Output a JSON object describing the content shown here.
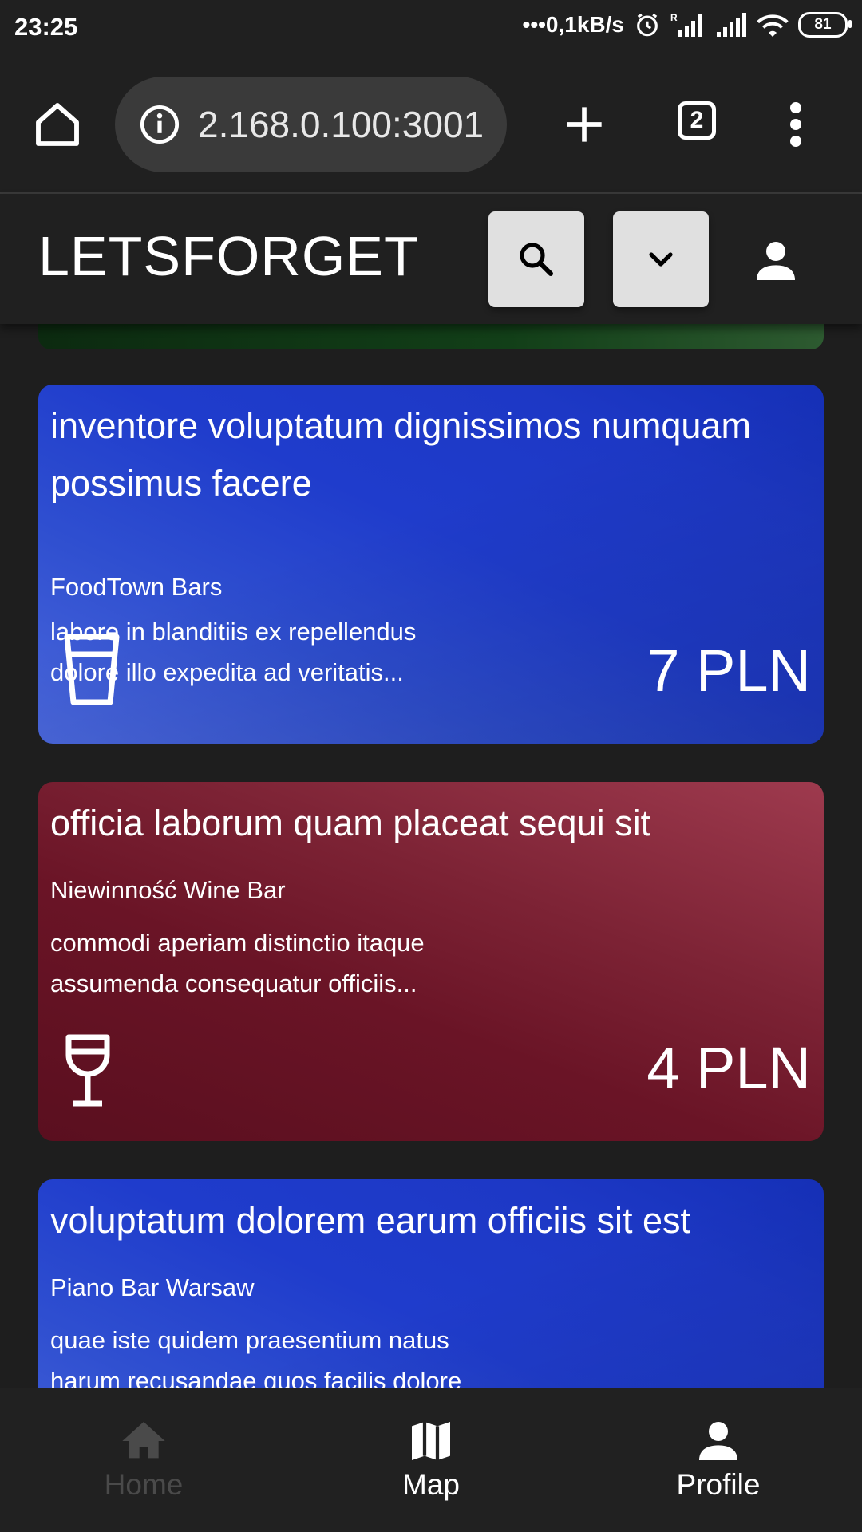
{
  "status": {
    "time": "23:25",
    "net_speed": "•••0,1kB/s",
    "battery": "81"
  },
  "browser": {
    "url": "2.168.0.100:3001",
    "tab_count": "2"
  },
  "app": {
    "brand": "LETSFORGET"
  },
  "offers": [
    {
      "title": "inventore voluptatum dignissimos numquam possimus facere",
      "venue": "FoodTown Bars",
      "description_line1": "labore in blanditiis ex repellendus",
      "description_line2": "dolore illo expedita ad veritatis...",
      "price": "7 PLN",
      "icon": "glass-icon",
      "color": "#2f4fd0"
    },
    {
      "title": "officia laborum quam placeat sequi sit",
      "venue": "Niewinność Wine Bar",
      "description_line1": "commodi aperiam distinctio itaque",
      "description_line2": "assumenda consequatur officiis...",
      "price": "4 PLN",
      "icon": "wine-glass-icon",
      "color": "#6a1426"
    },
    {
      "title": "voluptatum dolorem earum officiis sit est",
      "venue": "Piano Bar Warsaw",
      "description_line1": "quae iste quidem praesentium natus",
      "description_line2": "harum recusandae quos facilis dolore",
      "color": "#1f3ccc"
    }
  ],
  "bottom_nav": {
    "home_label": "Home",
    "map_label": "Map",
    "profile_label": "Profile",
    "active": "Map"
  }
}
